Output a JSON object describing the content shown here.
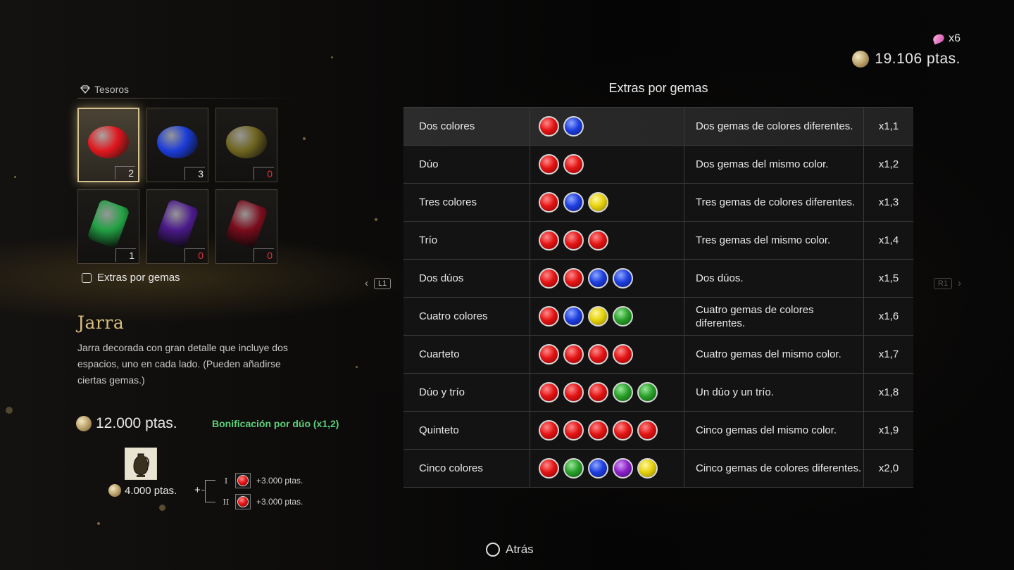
{
  "currency": {
    "spinel_count": "x6",
    "money": "19.106 ptas."
  },
  "treasures": {
    "label": "Tesoros",
    "gems": [
      {
        "name": "red-gem",
        "color": "#e0161e",
        "shape": "oval",
        "count": "2",
        "selected": true
      },
      {
        "name": "blue-gem",
        "color": "#1b3cd8",
        "shape": "oval",
        "count": "3",
        "selected": false
      },
      {
        "name": "yellow-gem",
        "color": "#6e6420",
        "shape": "oval",
        "count": "0",
        "selected": false
      },
      {
        "name": "green-gem",
        "color": "#22a044",
        "shape": "rect",
        "count": "1",
        "selected": false
      },
      {
        "name": "purple-gem",
        "color": "#4a1a8a",
        "shape": "rect",
        "count": "0",
        "selected": false
      },
      {
        "name": "crimson-gem",
        "color": "#7a0c1c",
        "shape": "rect",
        "count": "0",
        "selected": false
      }
    ],
    "extras_button": "Extras por gemas"
  },
  "item": {
    "name": "Jarra",
    "description": "Jarra decorada con gran detalle que incluye dos espacios, uno en cada lado. (Pueden añadirse ciertas gemas.)",
    "total_price": "12.000 ptas.",
    "bonus": "Bonificación por dúo (x1,2)",
    "base_price": "4.000 ptas.",
    "plus": "+",
    "slots": [
      {
        "roman": "I",
        "gem_color": "#e0161e",
        "value": "+3.000 ptas."
      },
      {
        "roman": "II",
        "gem_color": "#e0161e",
        "value": "+3.000 ptas."
      }
    ]
  },
  "table": {
    "title": "Extras por gemas",
    "rows": [
      {
        "name": "Dos colores",
        "gems": [
          "red",
          "blue"
        ],
        "desc": "Dos gemas de colores diferentes.",
        "mult": "x1,1"
      },
      {
        "name": "Dúo",
        "gems": [
          "red",
          "red"
        ],
        "desc": "Dos gemas del mismo color.",
        "mult": "x1,2"
      },
      {
        "name": "Tres colores",
        "gems": [
          "red",
          "blue",
          "yellow"
        ],
        "desc": "Tres gemas de colores diferentes.",
        "mult": "x1,3"
      },
      {
        "name": "Trío",
        "gems": [
          "red",
          "red",
          "red"
        ],
        "desc": "Tres gemas del mismo color.",
        "mult": "x1,4"
      },
      {
        "name": "Dos dúos",
        "gems": [
          "red",
          "red",
          "blue",
          "blue"
        ],
        "desc": "Dos dúos.",
        "mult": "x1,5"
      },
      {
        "name": "Cuatro colores",
        "gems": [
          "red",
          "blue",
          "yellow",
          "green"
        ],
        "desc": "Cuatro gemas de colores diferentes.",
        "mult": "x1,6"
      },
      {
        "name": "Cuarteto",
        "gems": [
          "red",
          "red",
          "red",
          "red"
        ],
        "desc": "Cuatro gemas del mismo color.",
        "mult": "x1,7"
      },
      {
        "name": "Dúo y trío",
        "gems": [
          "red",
          "red",
          "red",
          "green",
          "green"
        ],
        "desc": "Un dúo y un trío.",
        "mult": "x1,8"
      },
      {
        "name": "Quinteto",
        "gems": [
          "red",
          "red",
          "red",
          "red",
          "red"
        ],
        "desc": "Cinco gemas del mismo color.",
        "mult": "x1,9"
      },
      {
        "name": "Cinco colores",
        "gems": [
          "red",
          "green",
          "blue",
          "purple",
          "yellow"
        ],
        "desc": "Cinco gemas de colores diferentes.",
        "mult": "x2,0"
      }
    ]
  },
  "nav": {
    "left_button": "L1",
    "right_button": "R1",
    "left_arrow": "‹",
    "right_arrow": "›"
  },
  "footer": {
    "back_label": "Atrás"
  }
}
